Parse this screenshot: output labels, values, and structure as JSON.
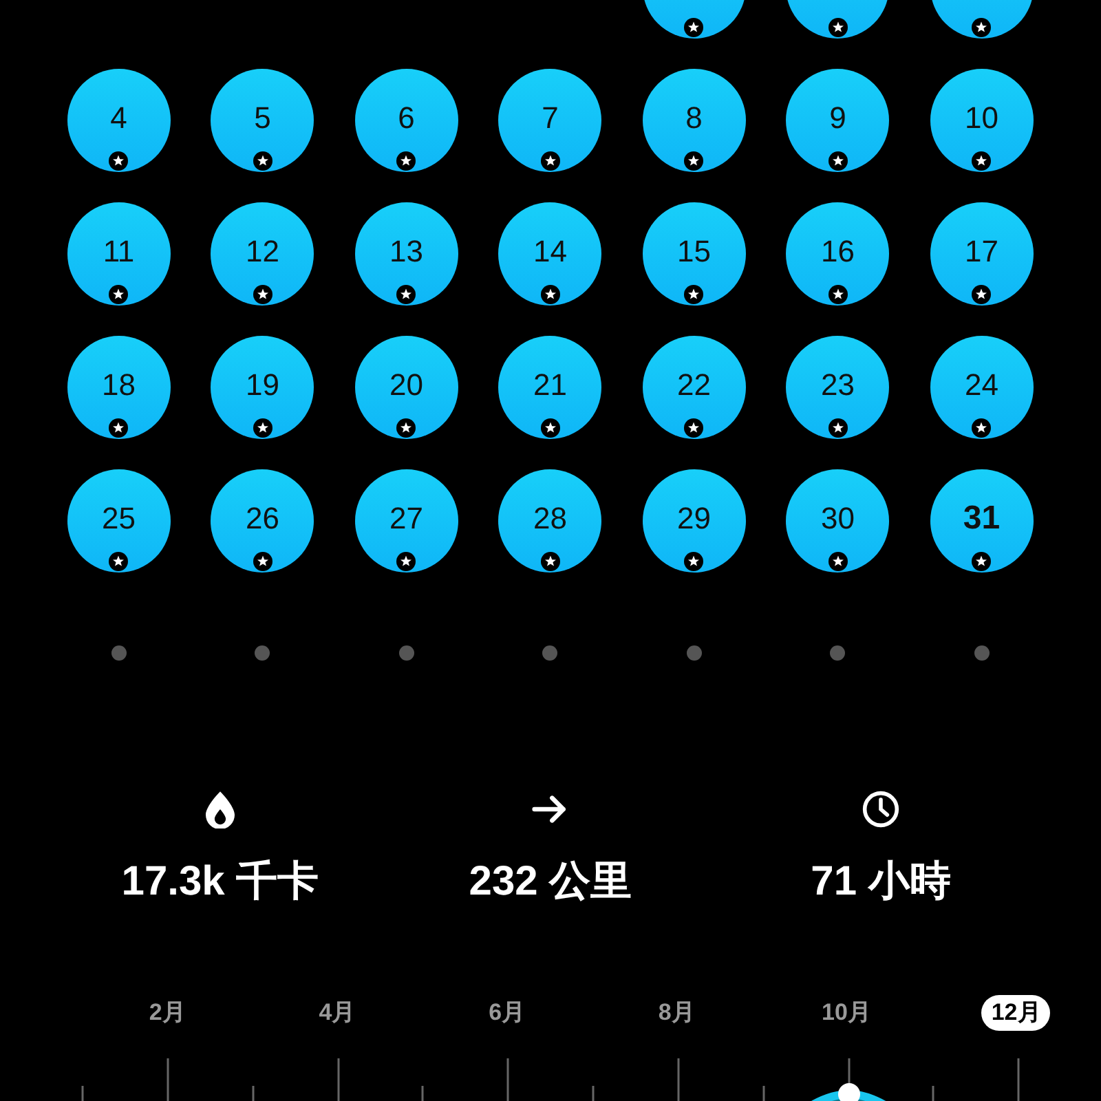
{
  "calendar": {
    "days": [
      {
        "starred": true
      },
      {
        "starred": true
      },
      {
        "starred": true
      },
      {
        "label": "4",
        "starred": true,
        "today": false
      },
      {
        "label": "5",
        "starred": true,
        "today": false
      },
      {
        "label": "6",
        "starred": true,
        "today": false
      },
      {
        "label": "7",
        "starred": true,
        "today": false
      },
      {
        "label": "8",
        "starred": true,
        "today": false
      },
      {
        "label": "9",
        "starred": true,
        "today": false
      },
      {
        "label": "10",
        "starred": true,
        "today": false
      },
      {
        "label": "11",
        "starred": true,
        "today": false
      },
      {
        "label": "12",
        "starred": true,
        "today": false
      },
      {
        "label": "13",
        "starred": true,
        "today": false
      },
      {
        "label": "14",
        "starred": true,
        "today": false
      },
      {
        "label": "15",
        "starred": true,
        "today": false
      },
      {
        "label": "16",
        "starred": true,
        "today": false
      },
      {
        "label": "17",
        "starred": true,
        "today": false
      },
      {
        "label": "18",
        "starred": true,
        "today": false
      },
      {
        "label": "19",
        "starred": true,
        "today": false
      },
      {
        "label": "20",
        "starred": true,
        "today": false
      },
      {
        "label": "21",
        "starred": true,
        "today": false
      },
      {
        "label": "22",
        "starred": true,
        "today": false
      },
      {
        "label": "23",
        "starred": true,
        "today": false
      },
      {
        "label": "24",
        "starred": true,
        "today": false
      },
      {
        "label": "25",
        "starred": true,
        "today": false
      },
      {
        "label": "26",
        "starred": true,
        "today": false
      },
      {
        "label": "27",
        "starred": true,
        "today": false
      },
      {
        "label": "28",
        "starred": true,
        "today": false
      },
      {
        "label": "29",
        "starred": true,
        "today": false
      },
      {
        "label": "30",
        "starred": true,
        "today": false
      },
      {
        "label": "31",
        "starred": true,
        "today": true
      }
    ]
  },
  "stats": [
    {
      "kind": "energy",
      "value": "17.3k 千卡"
    },
    {
      "kind": "distance",
      "value": "232 公里"
    },
    {
      "kind": "time",
      "value": "71 小時"
    }
  ],
  "timeline": {
    "months": [
      {
        "label": "2月",
        "selected": false
      },
      {
        "label": "4月",
        "selected": false
      },
      {
        "label": "6月",
        "selected": false
      },
      {
        "label": "8月",
        "selected": false
      },
      {
        "label": "10月",
        "selected": false
      },
      {
        "label": "12月",
        "selected": true
      }
    ]
  }
}
